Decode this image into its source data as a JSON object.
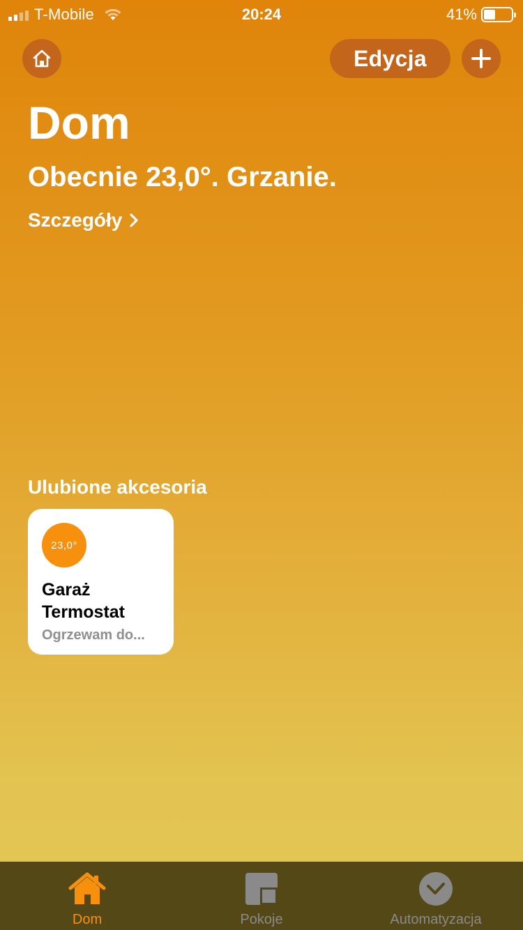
{
  "status_bar": {
    "carrier": "T-Mobile",
    "time": "20:24",
    "battery": "41%",
    "battery_level": 0.41
  },
  "header": {
    "home_icon": "house-icon",
    "edit_label": "Edycja",
    "add_icon": "plus-icon",
    "title": "Dom",
    "summary": "Obecnie 23,0°. Grzanie.",
    "details_label": "Szczegóły",
    "details_icon": "chevron-right-icon"
  },
  "favorites": {
    "section_title": "Ulubione akcesoria",
    "tiles": [
      {
        "badge": "23,0°",
        "name_line1": "Garaż",
        "name_line2": "Termostat",
        "status": "Ogrzewam do..."
      }
    ]
  },
  "tab_bar": {
    "tabs": [
      {
        "label": "Dom",
        "icon": "house-icon",
        "active": true
      },
      {
        "label": "Pokoje",
        "icon": "rooms-icon",
        "active": false
      },
      {
        "label": "Automatyzacja",
        "icon": "clock-check-icon",
        "active": false
      }
    ]
  },
  "colors": {
    "accent": "#f7900d",
    "button_bg": "#c4651c",
    "tab_bar_bg": "#554817"
  }
}
